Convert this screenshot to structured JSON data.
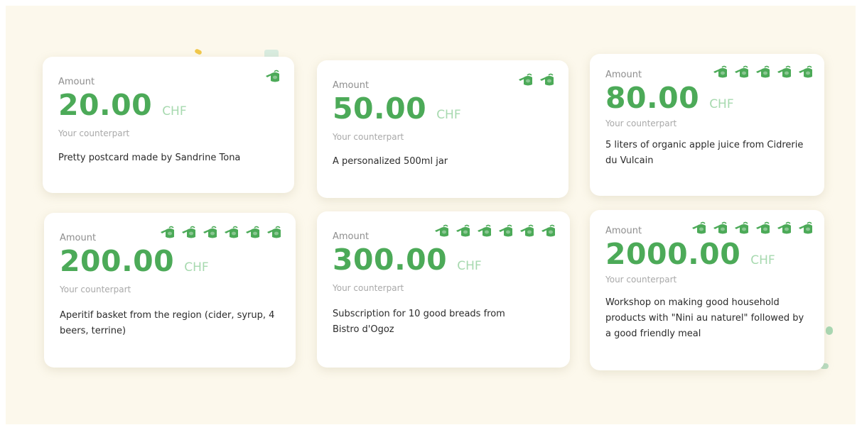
{
  "colors": {
    "accent": "#4caa58",
    "currency": "#a7d9af",
    "background": "#fcf8ec"
  },
  "icon_name": "watering-can-icon",
  "cards": [
    {
      "amount_label": "Amount",
      "amount": "20.00",
      "currency": "CHF",
      "counterpart_label": "Your counterpart",
      "description": "Pretty postcard made by Sandrine Tona",
      "icon_count": 1
    },
    {
      "amount_label": "Amount",
      "amount": "50.00",
      "currency": "CHF",
      "counterpart_label": "Your counterpart",
      "description": "A personalized 500ml jar",
      "icon_count": 2
    },
    {
      "amount_label": "Amount",
      "amount": "80.00",
      "currency": "CHF",
      "counterpart_label": "Your counterpart",
      "description": "5 liters of organic apple juice from Cidrerie du Vulcain",
      "icon_count": 5
    },
    {
      "amount_label": "Amount",
      "amount": "200.00",
      "currency": "CHF",
      "counterpart_label": "Your counterpart",
      "description": "Aperitif basket from the region (cider, syrup, 4 beers, terrine)",
      "icon_count": 6
    },
    {
      "amount_label": "Amount",
      "amount": "300.00",
      "currency": "CHF",
      "counterpart_label": "Your counterpart",
      "description": "Subscription for 10 good breads from Bistro d'Ogoz",
      "icon_count": 6
    },
    {
      "amount_label": "Amount",
      "amount": "2000.00",
      "currency": "CHF",
      "counterpart_label": "Your counterpart",
      "description": "Workshop on making good household products with \"Nini au naturel\" followed by a good friendly meal",
      "icon_count": 6
    }
  ]
}
